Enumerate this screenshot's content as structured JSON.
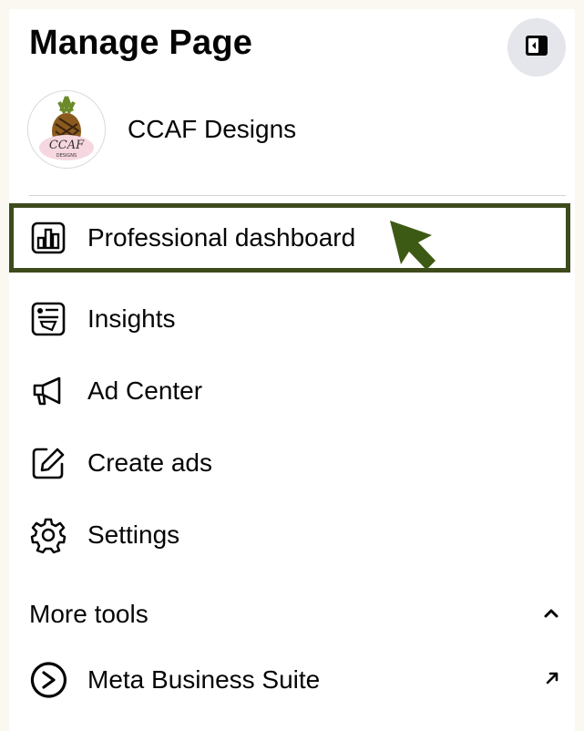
{
  "header": {
    "title": "Manage Page",
    "collapse_icon": "sidebar-collapse-icon"
  },
  "profile": {
    "name": "CCAF Designs",
    "avatar_text": "CCAF",
    "avatar_subtext": "DESIGNS"
  },
  "menu": {
    "items": [
      {
        "label": "Professional dashboard",
        "icon": "dashboard-icon",
        "highlighted": true
      },
      {
        "label": "Insights",
        "icon": "insights-icon"
      },
      {
        "label": "Ad Center",
        "icon": "megaphone-icon"
      },
      {
        "label": "Create ads",
        "icon": "edit-icon"
      },
      {
        "label": "Settings",
        "icon": "gear-icon"
      }
    ]
  },
  "more_tools": {
    "title": "More tools",
    "expanded": true,
    "items": [
      {
        "label": "Meta Business Suite",
        "icon": "meta-business-suite-icon",
        "external": true
      }
    ]
  },
  "colors": {
    "highlight_border": "#3d4b1c",
    "cursor": "#3d5a14",
    "background": "#fbf8f2"
  }
}
